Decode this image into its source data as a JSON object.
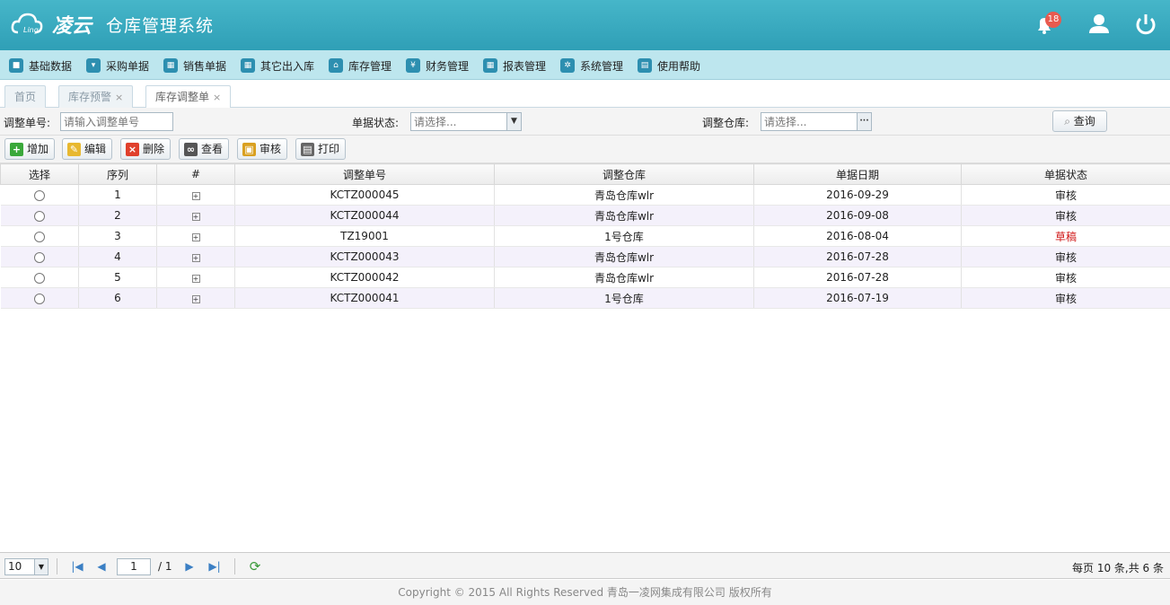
{
  "header": {
    "brand": "凌云",
    "title": "仓库管理系统",
    "notification_count": "18",
    "logo_text": "Ling"
  },
  "menu": [
    {
      "label": "基础数据",
      "icon": "cube-icon"
    },
    {
      "label": "采购单据",
      "icon": "basket-icon"
    },
    {
      "label": "销售单据",
      "icon": "calendar-icon"
    },
    {
      "label": "其它出入库",
      "icon": "calendar-icon"
    },
    {
      "label": "库存管理",
      "icon": "home-icon"
    },
    {
      "label": "财务管理",
      "icon": "money-icon"
    },
    {
      "label": "报表管理",
      "icon": "calendar-icon"
    },
    {
      "label": "系统管理",
      "icon": "gear-icon"
    },
    {
      "label": "使用帮助",
      "icon": "book-icon"
    }
  ],
  "tabs": [
    {
      "label": "首页"
    },
    {
      "label": "库存预警",
      "close": "×"
    },
    {
      "label": "库存调整单",
      "close": "×"
    }
  ],
  "search": {
    "order_no_label": "调整单号:",
    "order_no_placeholder": "请输入调整单号",
    "status_label": "单据状态:",
    "status_placeholder": "请选择...",
    "warehouse_label": "调整仓库:",
    "warehouse_placeholder": "请选择...",
    "query_label": "查询"
  },
  "toolbar": {
    "add": "增加",
    "edit": "编辑",
    "delete": "删除",
    "view": "查看",
    "audit": "审核",
    "print": "打印"
  },
  "table": {
    "headers": [
      "选择",
      "序列",
      "#",
      "调整单号",
      "调整仓库",
      "单据日期",
      "单据状态"
    ],
    "rows": [
      {
        "seq": "1",
        "no": "KCTZ000045",
        "warehouse": "青岛仓库wlr",
        "date": "2016-09-29",
        "status": "审核"
      },
      {
        "seq": "2",
        "no": "KCTZ000044",
        "warehouse": "青岛仓库wlr",
        "date": "2016-09-08",
        "status": "审核"
      },
      {
        "seq": "3",
        "no": "TZ19001",
        "warehouse": "1号仓库",
        "date": "2016-08-04",
        "status": "草稿"
      },
      {
        "seq": "4",
        "no": "KCTZ000043",
        "warehouse": "青岛仓库wlr",
        "date": "2016-07-28",
        "status": "审核"
      },
      {
        "seq": "5",
        "no": "KCTZ000042",
        "warehouse": "青岛仓库wlr",
        "date": "2016-07-28",
        "status": "审核"
      },
      {
        "seq": "6",
        "no": "KCTZ000041",
        "warehouse": "1号仓库",
        "date": "2016-07-19",
        "status": "审核"
      }
    ]
  },
  "pager": {
    "page_size": "10",
    "current_page": "1",
    "total_pages": "/ 1",
    "summary": "每页 10 条,共 6 条"
  },
  "footer": {
    "copyright": "Copyright © 2015 All Rights Reserved 青岛一凌网集成有限公司 版权所有"
  },
  "colors": {
    "header": "#3aabc1",
    "menubar": "#bde6ee",
    "draft_status": "#d01a1a"
  }
}
